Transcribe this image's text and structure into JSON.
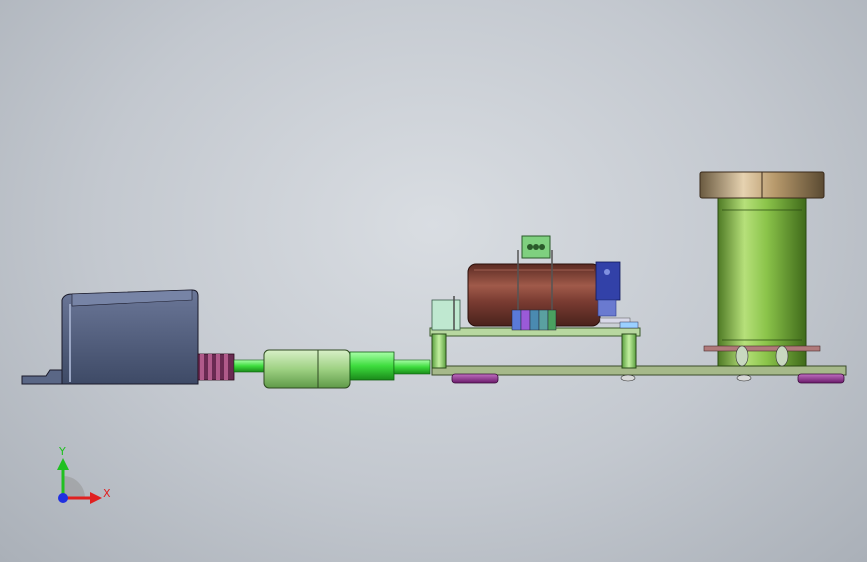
{
  "viewport": {
    "background_colors": [
      "#d9dde2",
      "#aab0b8"
    ]
  },
  "model": {
    "parts": [
      {
        "name": "power-adapter",
        "color": "#4d5a78"
      },
      {
        "name": "cable-strain-relief",
        "color": "#8e3f6a"
      },
      {
        "name": "cable-connector",
        "color": "#9ed183"
      },
      {
        "name": "cable",
        "color": "#3ddc3d"
      },
      {
        "name": "base-plate",
        "color": "#a6b98a"
      },
      {
        "name": "bracket-frame",
        "color": "#8ed46a"
      },
      {
        "name": "motor-body",
        "color": "#7a3c32"
      },
      {
        "name": "motor-driver-board",
        "color": "#3241a8"
      },
      {
        "name": "terminal-block",
        "color": "#6fc2a0"
      },
      {
        "name": "turntable-column",
        "color": "#8bc44a"
      },
      {
        "name": "turntable-top",
        "color": "#b89a6c"
      },
      {
        "name": "rubber-feet",
        "color": "#8a2b8a"
      }
    ]
  },
  "triad": {
    "x_label": "X",
    "y_label": "Y",
    "x_color": "#e02020",
    "y_color": "#20c020",
    "z_color": "#2030e0"
  }
}
